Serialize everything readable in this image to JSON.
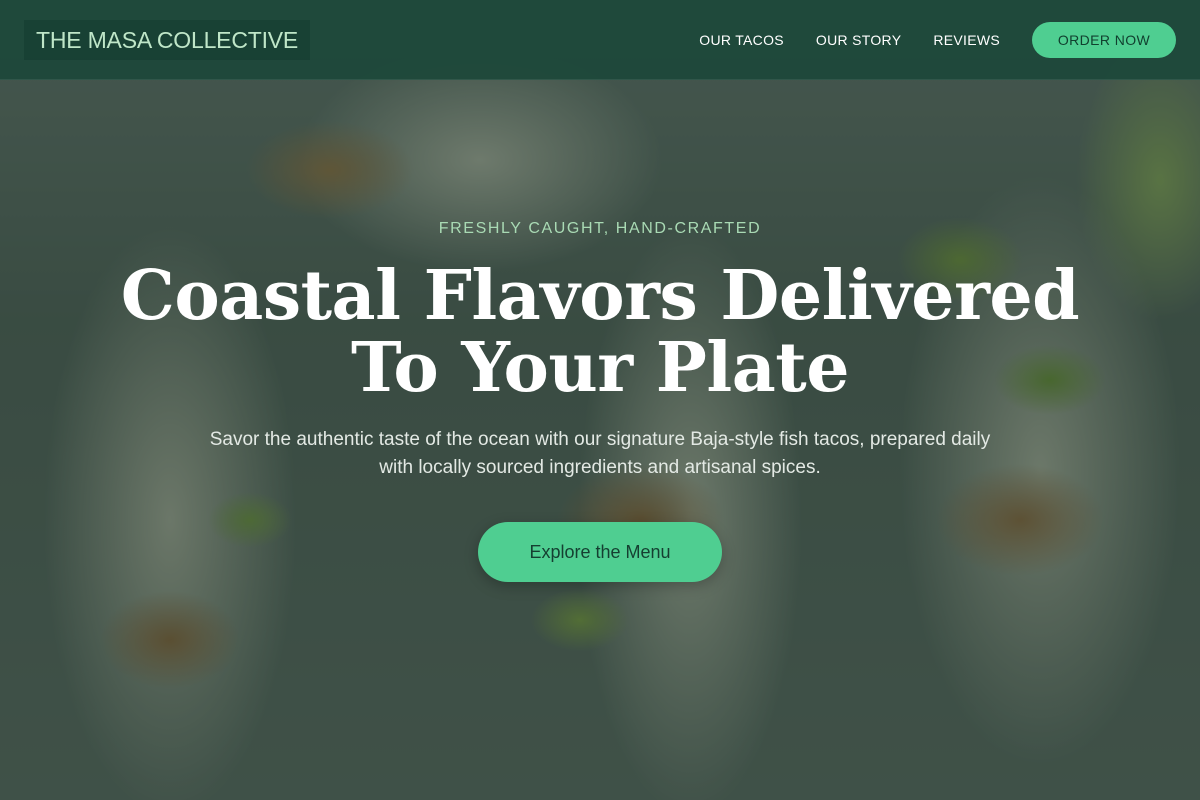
{
  "header": {
    "brand": "THE MASA COLLECTIVE",
    "nav": [
      {
        "label": "OUR TACOS"
      },
      {
        "label": "OUR STORY"
      },
      {
        "label": "REVIEWS"
      }
    ],
    "order_button": "ORDER NOW"
  },
  "hero": {
    "eyebrow": "FRESHLY CAUGHT, HAND-CRAFTED",
    "headline_line1": "Coastal Flavors Delivered",
    "headline_line2": "To Your Plate",
    "subtitle": "Savor the authentic taste of the ocean with our signature Baja-style fish tacos, prepared daily with locally sourced ingredients and artisanal spices.",
    "cta": "Explore the Menu"
  },
  "colors": {
    "header_bg": "#1c483a",
    "accent": "#4fce91",
    "eyebrow": "#a9dab4",
    "brand_text": "#bfe6c8"
  }
}
